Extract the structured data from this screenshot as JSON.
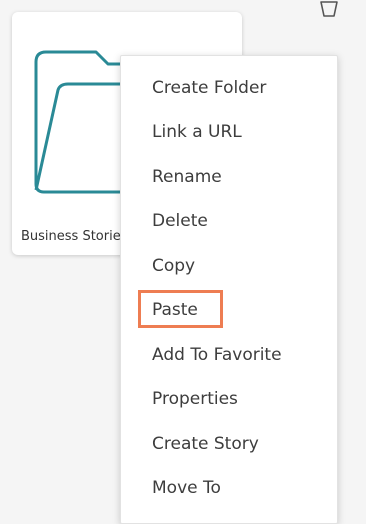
{
  "folder": {
    "name": "Business Stories",
    "icon": "folder-icon",
    "icon_color": "#2a8a96"
  },
  "corner_icon": "notification-icon",
  "context_menu": {
    "items": [
      {
        "label": "Create Folder"
      },
      {
        "label": "Link a URL"
      },
      {
        "label": "Rename"
      },
      {
        "label": "Delete"
      },
      {
        "label": "Copy"
      },
      {
        "label": "Paste",
        "highlighted": true
      },
      {
        "label": "Add To Favorite"
      },
      {
        "label": "Properties"
      },
      {
        "label": "Create Story"
      },
      {
        "label": "Move To"
      }
    ],
    "highlight_color": "#ee7d52"
  }
}
